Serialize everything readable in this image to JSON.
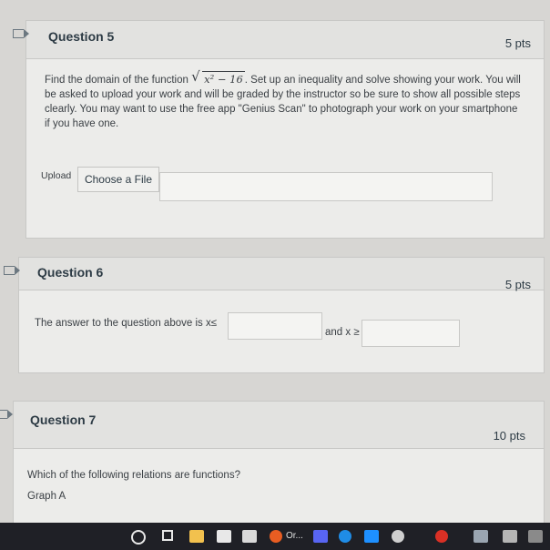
{
  "questions": {
    "q5": {
      "title": "Question 5",
      "points": "5 pts",
      "text_before": "Find the domain of the function",
      "radicand": "x² − 16",
      "text_after": ". Set up an inequality and solve showing your work. You will be asked to upload your work and will be graded by the instructor so be sure to show all possible steps clearly. You may want to use the free app \"Genius Scan\" to photograph your work on your smartphone if you have one.",
      "upload_label": "Upload",
      "choose_file_label": "Choose a File"
    },
    "q6": {
      "title": "Question 6",
      "points": "5 pts",
      "text_lead": "The answer to the question above is x",
      "text_mid": "and x",
      "leq": "≤",
      "geq": "≥"
    },
    "q7": {
      "title": "Question 7",
      "points": "10 pts",
      "prompt": "Which of the following relations are functions?",
      "sub": "Graph A"
    }
  },
  "taskbar": {
    "app_label": "Or..."
  },
  "colors": {
    "taskbar": "#1f2026",
    "panel": "#ececea"
  }
}
